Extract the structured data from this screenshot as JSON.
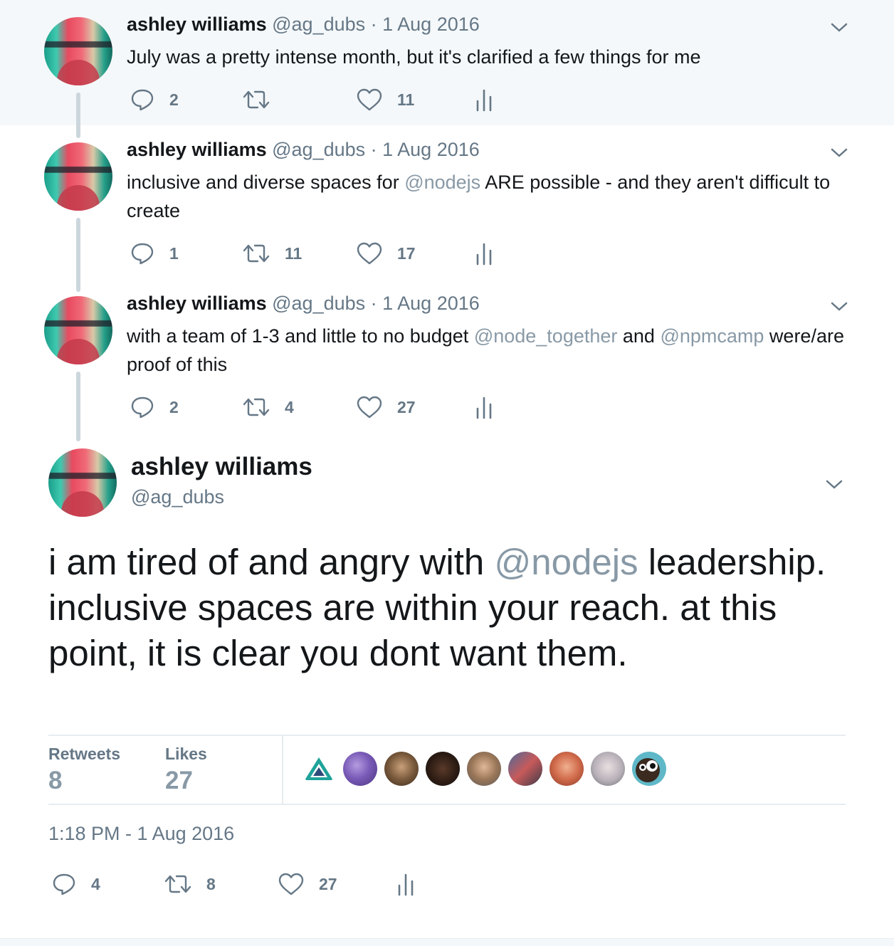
{
  "thread": [
    {
      "name": "ashley williams",
      "meta": "@ag_dubs · 1 Aug 2016",
      "text_parts": [
        {
          "text": "July was a pretty intense month, but it's clarified a few things for me",
          "mention": false
        }
      ],
      "replies": "2",
      "retweets": "",
      "likes": "11"
    },
    {
      "name": "ashley williams",
      "meta": "@ag_dubs · 1 Aug 2016",
      "text_parts": [
        {
          "text": "inclusive and diverse spaces for ",
          "mention": false
        },
        {
          "text": "@nodejs",
          "mention": true
        },
        {
          "text": " ARE possible - and they aren't difficult to create",
          "mention": false
        }
      ],
      "replies": "1",
      "retweets": "11",
      "likes": "17"
    },
    {
      "name": "ashley williams",
      "meta": "@ag_dubs · 1 Aug 2016",
      "text_parts": [
        {
          "text": "with a team of 1-3 and little to no budget ",
          "mention": false
        },
        {
          "text": "@node_together",
          "mention": true
        },
        {
          "text": " and ",
          "mention": false
        },
        {
          "text": "@npmcamp",
          "mention": true
        },
        {
          "text": " were/are proof of this",
          "mention": false
        }
      ],
      "replies": "2",
      "retweets": "4",
      "likes": "27"
    }
  ],
  "main": {
    "name": "ashley williams",
    "handle": "@ag_dubs",
    "text_parts": [
      {
        "text": "i am tired of and angry with ",
        "mention": false
      },
      {
        "text": "@nodejs",
        "mention": true
      },
      {
        "text": " leadership. inclusive spaces are within your reach. at this point, it is clear you dont want them.",
        "mention": false
      }
    ],
    "retweets_label": "Retweets",
    "retweets_value": "8",
    "likes_label": "Likes",
    "likes_value": "27",
    "timestamp": "1:18 PM - 1 Aug 2016",
    "replies": "4",
    "retweets": "8",
    "likes": "27"
  },
  "icons": {
    "reply": "reply-icon",
    "retweet": "retweet-icon",
    "like": "heart-icon",
    "analytics": "analytics-icon",
    "more": "chevron-down-icon"
  },
  "colors": {
    "mention": "#8899a6",
    "muted": "#657786",
    "highlight_bg": "#f5f8fa",
    "thread_line": "#ccd6dd"
  }
}
